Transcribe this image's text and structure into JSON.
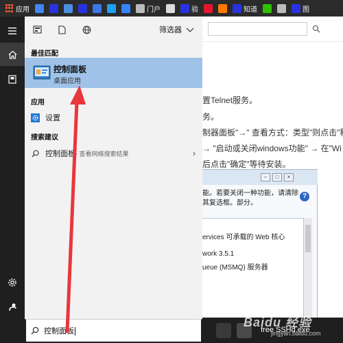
{
  "bookmarks": [
    {
      "label": "应用",
      "icon": "apps-grid-icon",
      "color": "#e4572e"
    },
    {
      "label": "",
      "icon": "google-icon",
      "color": "#4285f4"
    },
    {
      "label": "",
      "icon": "baidu-paw-icon",
      "color": "#2932e1"
    },
    {
      "label": "",
      "icon": "translate-icon",
      "color": "#4a90e2"
    },
    {
      "label": "",
      "icon": "baidu-paw-icon",
      "color": "#2932e1"
    },
    {
      "label": "",
      "icon": "grid-app-icon",
      "color": "#3b78e7"
    },
    {
      "label": "",
      "icon": "twitter-bird-icon",
      "color": "#1da1f2"
    },
    {
      "label": "",
      "icon": "zhidao-bubble-icon",
      "color": "#3385ff"
    },
    {
      "label": "门户",
      "icon": "page-icon",
      "color": "#bbbbbb"
    },
    {
      "label": "",
      "icon": "document-icon",
      "color": "#dddddd"
    },
    {
      "label": "验",
      "icon": "baidu-paw-icon",
      "color": "#2932e1"
    },
    {
      "label": "",
      "icon": "weibo-icon",
      "color": "#e6162d"
    },
    {
      "label": "",
      "icon": "orange-logo-icon",
      "color": "#ff7a00"
    },
    {
      "label": "知道",
      "icon": "baidu-paw-icon",
      "color": "#2932e1"
    },
    {
      "label": "",
      "icon": "wechat-icon",
      "color": "#2dc100"
    },
    {
      "label": "",
      "icon": "page-icon",
      "color": "#bbbbbb"
    },
    {
      "label": "图",
      "icon": "baidu-paw-icon",
      "color": "#2932e1"
    }
  ],
  "search_panel": {
    "filter_label": "筛选器",
    "best_match_header": "最佳匹配",
    "best_match_title": "控制面板",
    "best_match_subtitle": "桌面应用",
    "apps_header": "应用",
    "settings_label": "设置",
    "suggestions_header": "搜索建议",
    "suggestion_query": "控制面板",
    "suggestion_hint": " - 查看网络搜索结果"
  },
  "search_box": {
    "value": "控制面板"
  },
  "background_page": {
    "lines": [
      "置Telnet服务。",
      "务。",
      "制器面板\"→\" 查看方式：类型\"则点击\"程",
      "→ \"启动或关闭windows功能\" → 在\"Wi",
      "后点击\"确定\"等待安装。"
    ],
    "dialog_desc": "能。若要关闭一种功能，请清除其复选框。部分。",
    "dialog_items": [
      "ervices 可承载的 Web 核心",
      "work 3.5.1",
      "ueue (MSMQ) 服务器"
    ]
  },
  "taskbar": {
    "label": "free SSHd.exe"
  },
  "watermark": {
    "main": "Baidu 经验",
    "sub": "jingyan.baidu.com"
  },
  "colors": {
    "accent_selected": "#9fc3e8",
    "arrow": "#e8363c",
    "panel_bg": "#f2f2f2",
    "strip_bg": "#1f1f1f"
  }
}
